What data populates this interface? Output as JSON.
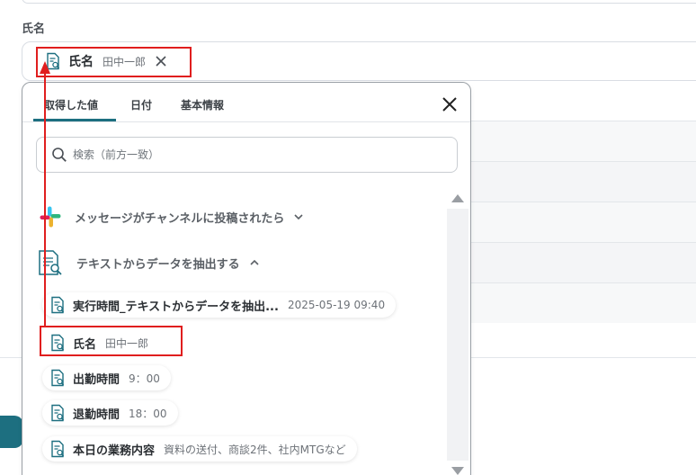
{
  "field": {
    "label": "氏名",
    "chip": {
      "label": "氏名",
      "value": "田中一郎"
    }
  },
  "panel": {
    "tabs": [
      {
        "label": "取得した値",
        "active": true
      },
      {
        "label": "日付",
        "active": false
      },
      {
        "label": "基本情報",
        "active": false
      }
    ],
    "search": {
      "placeholder": "検索（前方一致）",
      "value": ""
    },
    "groups": [
      {
        "label": "メッセージがチャンネルに投稿されたら",
        "icon": "slack-icon",
        "expanded": false
      },
      {
        "label": "テキストからデータを抽出する",
        "icon": "text-extract-icon",
        "expanded": true
      }
    ],
    "items": [
      {
        "label": "実行時間_テキストからデータを抽出...",
        "value": "2025-05-19 09:40"
      },
      {
        "label": "氏名",
        "value": "田中一郎",
        "highlighted": true
      },
      {
        "label": "出勤時間",
        "value": "9：00"
      },
      {
        "label": "退勤時間",
        "value": "18：00"
      },
      {
        "label": "本日の業務内容",
        "value": "資料の送付、商談2件、社内MTGなど"
      }
    ]
  },
  "colors": {
    "accent": "#1d6f80",
    "highlight": "#e01e1e",
    "icon_teal": "#1d6f80"
  }
}
